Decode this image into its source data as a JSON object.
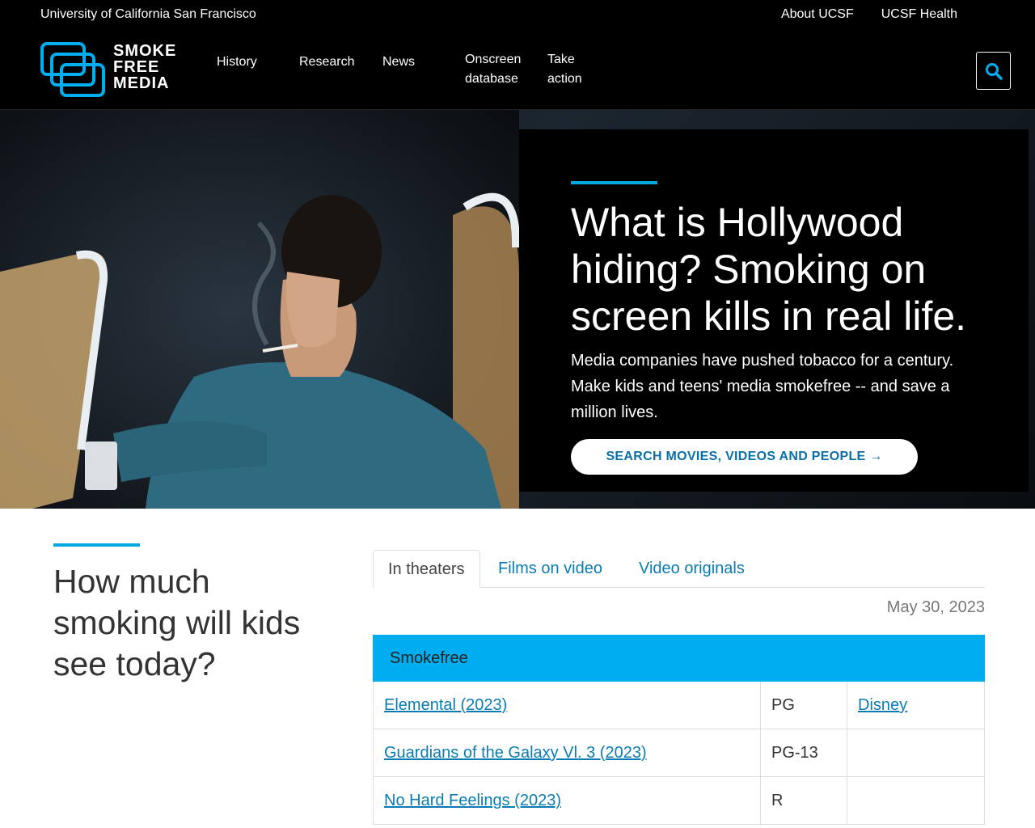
{
  "utility_bar": {
    "university": "University of California San Francisco",
    "links": [
      "About UCSF",
      "UCSF Health"
    ]
  },
  "header": {
    "logo_lines": [
      "SMOKE",
      "FREE",
      "MEDIA"
    ],
    "nav": [
      {
        "label": "History"
      },
      {
        "label": "Research"
      },
      {
        "label": "News"
      },
      {
        "label_line1": "Onscreen",
        "label_line2": "database"
      },
      {
        "label_line1": "Take",
        "label_line2": "action"
      }
    ]
  },
  "hero": {
    "title": "What is Hollywood hiding? Smoking on screen kills in real life.",
    "subtitle": "Media companies have pushed tobacco for a century. Make kids and teens' media smokefree -- and save a million lives.",
    "cta": "SEARCH MOVIES, VIDEOS AND PEOPLE →"
  },
  "section": {
    "title": "How much smoking will kids see today?",
    "tabs": [
      "In theaters",
      "Films on video",
      "Video originals"
    ],
    "active_tab": "In theaters",
    "date": "May 30, 2023",
    "table_heading": "Smokefree",
    "rows": [
      {
        "title": "Elemental (2023)",
        "rating": "PG",
        "studio": "Disney"
      },
      {
        "title": "Guardians of the Galaxy Vl. 3 (2023)",
        "rating": "PG-13",
        "studio": ""
      },
      {
        "title": "No Hard Feelings (2023)",
        "rating": "R",
        "studio": ""
      }
    ]
  },
  "colors": {
    "accent": "#00a9e0",
    "link": "#0a7cb3",
    "header_bg": "#000000"
  }
}
